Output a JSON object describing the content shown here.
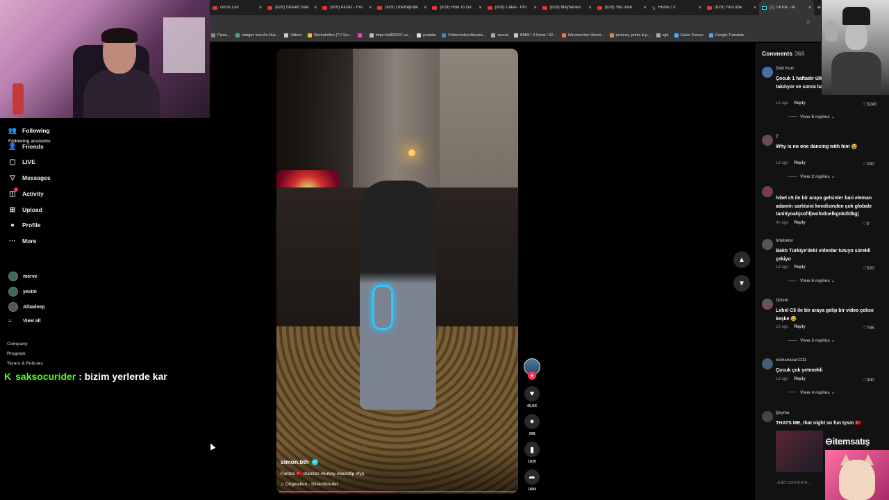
{
  "browser": {
    "tabs": [
      {
        "label": "cid vs Lev",
        "icon": "youtube"
      },
      {
        "label": "(829) Stream Saw",
        "icon": "youtube"
      },
      {
        "label": "(829) Ati242 - Fre",
        "icon": "youtube"
      },
      {
        "label": "(829) OneRepubli",
        "icon": "youtube"
      },
      {
        "label": "(829) How To Ge",
        "icon": "youtube"
      },
      {
        "label": "(829) Cakal - Pro",
        "icon": "youtube"
      },
      {
        "label": "(829) Meyhaneci",
        "icon": "youtube"
      },
      {
        "label": "(829) YouTube",
        "icon": "youtube"
      },
      {
        "label": "Home / X",
        "icon": "x"
      },
      {
        "label": "(829) YouTube",
        "icon": "youtube"
      },
      {
        "label": "(1) TikTok - M",
        "icon": "tiktok",
        "active": true
      }
    ],
    "bookmarks": [
      "Piyas...",
      "Images icon An illus...",
      "Videos",
      "Workaholics (TV Ser...",
      "",
      "https://ia800207.us...",
      "youtube",
      "Politechnika Warsza...",
      "secuzi",
      "BMW / 3 Serisi / 32...",
      "Windows'tan Ubunt...",
      "pictures, prints & p...",
      "sgh",
      "Gelen Kutusu",
      "Google Translate"
    ]
  },
  "nav": {
    "items": [
      {
        "label": "Following",
        "icon": "following-icon",
        "glyph": "👥"
      },
      {
        "label": "Friends",
        "icon": "friends-icon",
        "glyph": "👤"
      },
      {
        "label": "LIVE",
        "icon": "live-icon",
        "glyph": "▢"
      },
      {
        "label": "Messages",
        "icon": "messages-icon",
        "glyph": "▽"
      },
      {
        "label": "Activity",
        "icon": "activity-icon",
        "glyph": "◫"
      },
      {
        "label": "Upload",
        "icon": "upload-icon",
        "glyph": "⊞"
      },
      {
        "label": "Profile",
        "icon": "profile-icon",
        "glyph": "●"
      },
      {
        "label": "More",
        "icon": "more-icon",
        "glyph": "···"
      }
    ],
    "following_title": "Following accounts",
    "accounts": [
      "merve",
      "yesim",
      "Albadeep"
    ],
    "view_all": "View all",
    "footer": [
      "Company",
      "Program",
      "Terms & Policies"
    ]
  },
  "chat": {
    "user": "saksocurider",
    "message": ": bizim yerlerde kar"
  },
  "video": {
    "author": "simon.bth",
    "caption": "Pardon 🇹🇷 #tanzen #turkey #backflip #fyp",
    "music": "Originalton - Streichbruder",
    "progress": 0.49,
    "likes": "40.6K",
    "comments": "368",
    "saves": "1820",
    "shares": "1894"
  },
  "comments_panel": {
    "title": "Comments",
    "count": "368",
    "add_placeholder": "Add comment...",
    "items": [
      {
        "user": "Zeki Kurt",
        "text": "Çocuk 1 haftadır ülkenin farklı konumlarda takılıyor ve sonra başladılar 😂",
        "time": "1d ago",
        "reply": "Reply",
        "likes": "3240",
        "replies": "View 8 replies"
      },
      {
        "user": "Z",
        "text": "Why is no one dancing with him 😭",
        "time": "1d ago",
        "reply": "Reply",
        "likes": "290",
        "replies": "View 2 replies"
      },
      {
        "user": "",
        "text": "lvbel c5 ile bir araya gelsinler bari eleman adamin sarkisini kendisinden çok globale tanitiyoahjsofifjwofodoelkgnkdldkgj",
        "time": "4h ago",
        "reply": "Reply",
        "likes": "0",
        "replies": ""
      },
      {
        "user": "İntebeter",
        "text": "Baktı Türkiye'deki videolar tutuyo sürekli çekiyo",
        "time": "1d ago",
        "reply": "Reply",
        "likes": "520",
        "replies": "View 6 replies"
      },
      {
        "user": "Ozlem",
        "text": "Lvbel C5 ile bir araya gelip bir video çekse keşke 😂",
        "time": "1d ago",
        "reply": "Reply",
        "likes": "786",
        "replies": "View 3 replies"
      },
      {
        "user": "osmanacar1111",
        "text": "Çocuk çok yetenekli",
        "time": "1d ago",
        "reply": "Reply",
        "likes": "390",
        "replies": "View 4 replies"
      },
      {
        "user": "Şeyma",
        "text": "THATS ME, that night so fun tysm 🇹🇷",
        "time": "",
        "reply": "",
        "likes": "",
        "replies": ""
      }
    ]
  },
  "overlay": {
    "sponsor": "itemsatış"
  }
}
